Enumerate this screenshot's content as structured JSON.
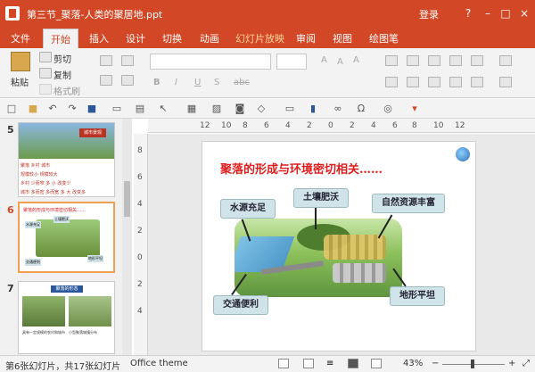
{
  "window": {
    "title": "第三节_聚落-人类的聚居地.ppt",
    "login": "登录"
  },
  "tabs": [
    "文件",
    "开始",
    "插入",
    "设计",
    "切换",
    "动画",
    "幻灯片放映",
    "审阅",
    "视图",
    "绘图笔"
  ],
  "ribbon": {
    "paste": "粘贴",
    "cut": "剪切",
    "copy": "复制",
    "format_painter": "格式刷"
  },
  "thumbnails": [
    {
      "num": "5",
      "title": "城市景观",
      "rows": [
        "聚落 乡村 城市",
        "规模较小 规模较大",
        "乡村 少而窄 多 小 改变少",
        "城市 多而密 多而宽 多 大 改变多"
      ]
    },
    {
      "num": "6",
      "title": "聚落的形成与环境密切相关……",
      "labels": [
        "水源充足",
        "土壤肥沃",
        "交通便利",
        "地形平坦"
      ]
    },
    {
      "num": "7",
      "title": "聚落的形态",
      "captions": [
        "具有一定规模的农村和城市",
        "小型聚落城镇分布"
      ]
    }
  ],
  "slide": {
    "title": "聚落的形成与环境密切相关……",
    "callouts": {
      "water": "水源充足",
      "soil": "土壤肥沃",
      "resources": "自然资源丰富",
      "transport": "交通便利",
      "terrain": "地形平坦"
    }
  },
  "ruler": {
    "h": [
      "12",
      "10",
      "8",
      "6",
      "4",
      "2",
      "0",
      "2",
      "4",
      "6",
      "8",
      "10",
      "12"
    ],
    "v": [
      "8",
      "6",
      "4",
      "2",
      "0",
      "2",
      "4"
    ]
  },
  "status": {
    "slide_info": "第6张幻灯片，共17张幻灯片",
    "theme": "Office theme",
    "zoom": "43%"
  },
  "colors": {
    "accent": "#d24726",
    "title_red": "#e01d1d"
  }
}
